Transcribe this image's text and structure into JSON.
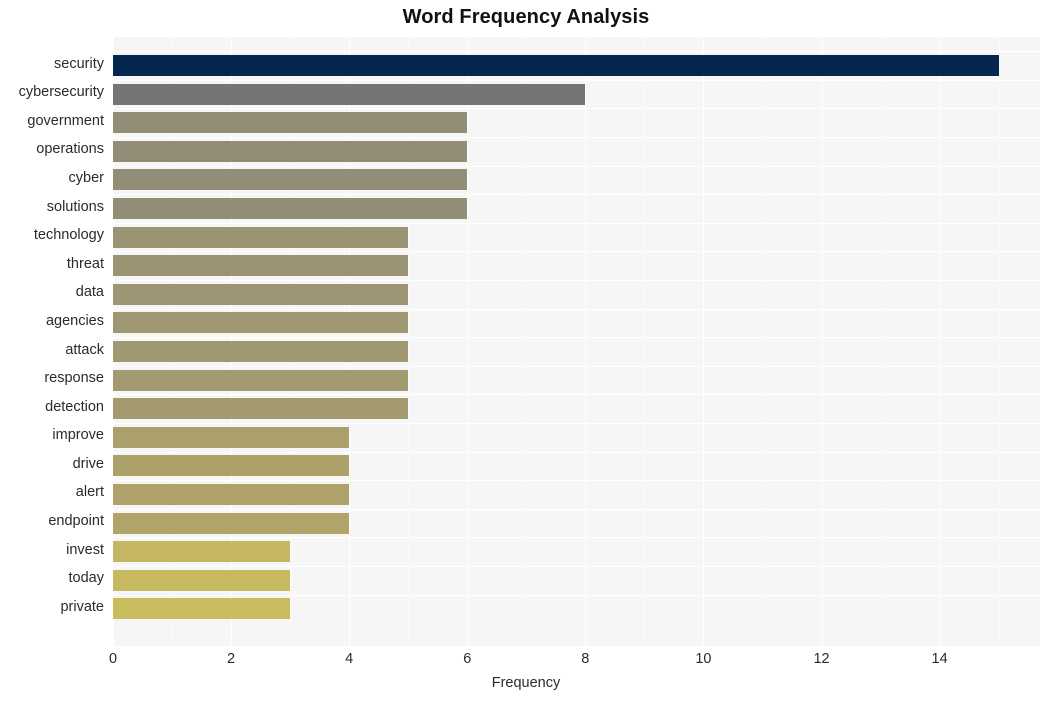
{
  "chart_data": {
    "type": "bar",
    "orientation": "horizontal",
    "title": "Word Frequency Analysis",
    "xlabel": "Frequency",
    "ylabel": "",
    "categories": [
      "security",
      "cybersecurity",
      "government",
      "operations",
      "cyber",
      "solutions",
      "technology",
      "threat",
      "data",
      "agencies",
      "attack",
      "response",
      "detection",
      "improve",
      "drive",
      "alert",
      "endpoint",
      "invest",
      "today",
      "private"
    ],
    "values": [
      15,
      8,
      6,
      6,
      6,
      6,
      5,
      5,
      5,
      5,
      5,
      5,
      5,
      4,
      4,
      4,
      4,
      3,
      3,
      3
    ],
    "bar_colors": [
      "#04264f",
      "#757575",
      "#918d77",
      "#918d77",
      "#918d77",
      "#918d77",
      "#9a9374",
      "#9a9374",
      "#9d9573",
      "#9f9772",
      "#a09871",
      "#a29a70",
      "#a39a6f",
      "#ab9f6b",
      "#ad a16a",
      "#aea26a",
      "#b0a469",
      "#c4b662",
      "#c7b960",
      "#c9bc5f"
    ],
    "xticks": [
      0,
      2,
      4,
      6,
      8,
      10,
      12,
      14
    ],
    "xlim": [
      0,
      15.7
    ],
    "grid": true,
    "legend": "none",
    "plot_background": "#f6f6f6",
    "gridline_color": "#ffffff",
    "figure_background": "#ffffff"
  }
}
